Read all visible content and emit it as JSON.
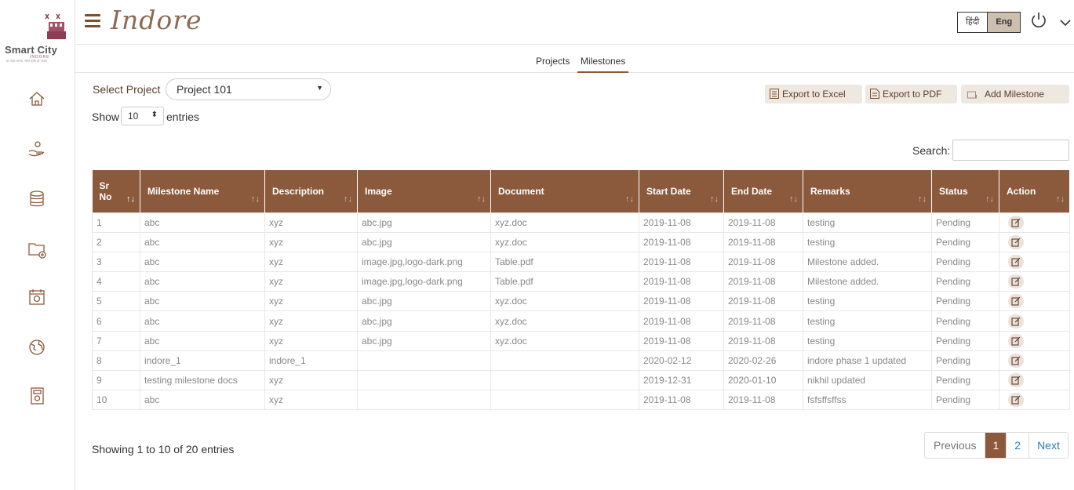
{
  "app": {
    "brand": "Indore",
    "logo_text": "Smart City",
    "logo_subtext": "INDORE",
    "logo_tagline": "हर शहर अपना, स्मार्ट इंदौर हो अपना"
  },
  "header": {
    "lang_hindi": "हिंदी",
    "lang_english": "Eng",
    "active_lang": "Eng"
  },
  "sidebar": {
    "items": [
      {
        "name": "home",
        "icon": "home-icon"
      },
      {
        "name": "hand-service",
        "icon": "hand-icon"
      },
      {
        "name": "database",
        "icon": "database-icon"
      },
      {
        "name": "add-folder",
        "icon": "folder-add-icon"
      },
      {
        "name": "calendar",
        "icon": "calendar-icon"
      },
      {
        "name": "globe",
        "icon": "globe-icon"
      },
      {
        "name": "report",
        "icon": "report-icon"
      }
    ]
  },
  "tabs": {
    "projects": "Projects",
    "milestones": "Milestones",
    "active": "Milestones"
  },
  "filters": {
    "select_project_label": "Select Project",
    "project_value": "Project 101",
    "show_label": "Show",
    "entries_value": "10",
    "entries_label": "entries",
    "search_label": "Search:",
    "search_value": ""
  },
  "toolbar": {
    "export_excel": "Export to Excel",
    "export_pdf": "Export to PDF",
    "add_milestone": "Add Milestone"
  },
  "table": {
    "columns": [
      "Sr No",
      "Milestone Name",
      "Description",
      "Image",
      "Document",
      "Start Date",
      "End Date",
      "Remarks",
      "Status",
      "Action"
    ],
    "rows": [
      [
        "1",
        "abc",
        "xyz",
        "abc.jpg",
        "xyz.doc",
        "2019-11-08",
        "2019-11-08",
        "testing",
        "Pending"
      ],
      [
        "2",
        "abc",
        "xyz",
        "abc.jpg",
        "xyz.doc",
        "2019-11-08",
        "2019-11-08",
        "testing",
        "Pending"
      ],
      [
        "3",
        "abc",
        "xyz",
        "image.jpg,logo-dark.png",
        "Table.pdf",
        "2019-11-08",
        "2019-11-08",
        "Milestone added.",
        "Pending"
      ],
      [
        "4",
        "abc",
        "xyz",
        "image.jpg,logo-dark.png",
        "Table.pdf",
        "2019-11-08",
        "2019-11-08",
        "Milestone added.",
        "Pending"
      ],
      [
        "5",
        "abc",
        "xyz",
        "abc.jpg",
        "xyz.doc",
        "2019-11-08",
        "2019-11-08",
        "testing",
        "Pending"
      ],
      [
        "6",
        "abc",
        "xyz",
        "abc.jpg",
        "xyz.doc",
        "2019-11-08",
        "2019-11-08",
        "testing",
        "Pending"
      ],
      [
        "7",
        "abc",
        "xyz",
        "abc.jpg",
        "xyz.doc",
        "2019-11-08",
        "2019-11-08",
        "testing",
        "Pending"
      ],
      [
        "8",
        "indore_1",
        "indore_1",
        "",
        "",
        "2020-02-12",
        "2020-02-26",
        "indore phase 1 updated",
        "Pending"
      ],
      [
        "9",
        "testing milestone docs",
        "xyz",
        "",
        "",
        "2019-12-31",
        "2020-01-10",
        "nikhil updated",
        "Pending"
      ],
      [
        "10",
        "abc",
        "xyz",
        "",
        "",
        "2019-11-08",
        "2019-11-08",
        "fsfsffsffss",
        "Pending"
      ]
    ]
  },
  "footer": {
    "info": "Showing 1 to 10 of 20 entries",
    "prev": "Previous",
    "pages": [
      "1",
      "2"
    ],
    "current_page": "1",
    "next": "Next"
  },
  "colors": {
    "primary": "#8b5a3c",
    "button_bg": "#efe8e1",
    "lang_active": "#cdbfae"
  }
}
